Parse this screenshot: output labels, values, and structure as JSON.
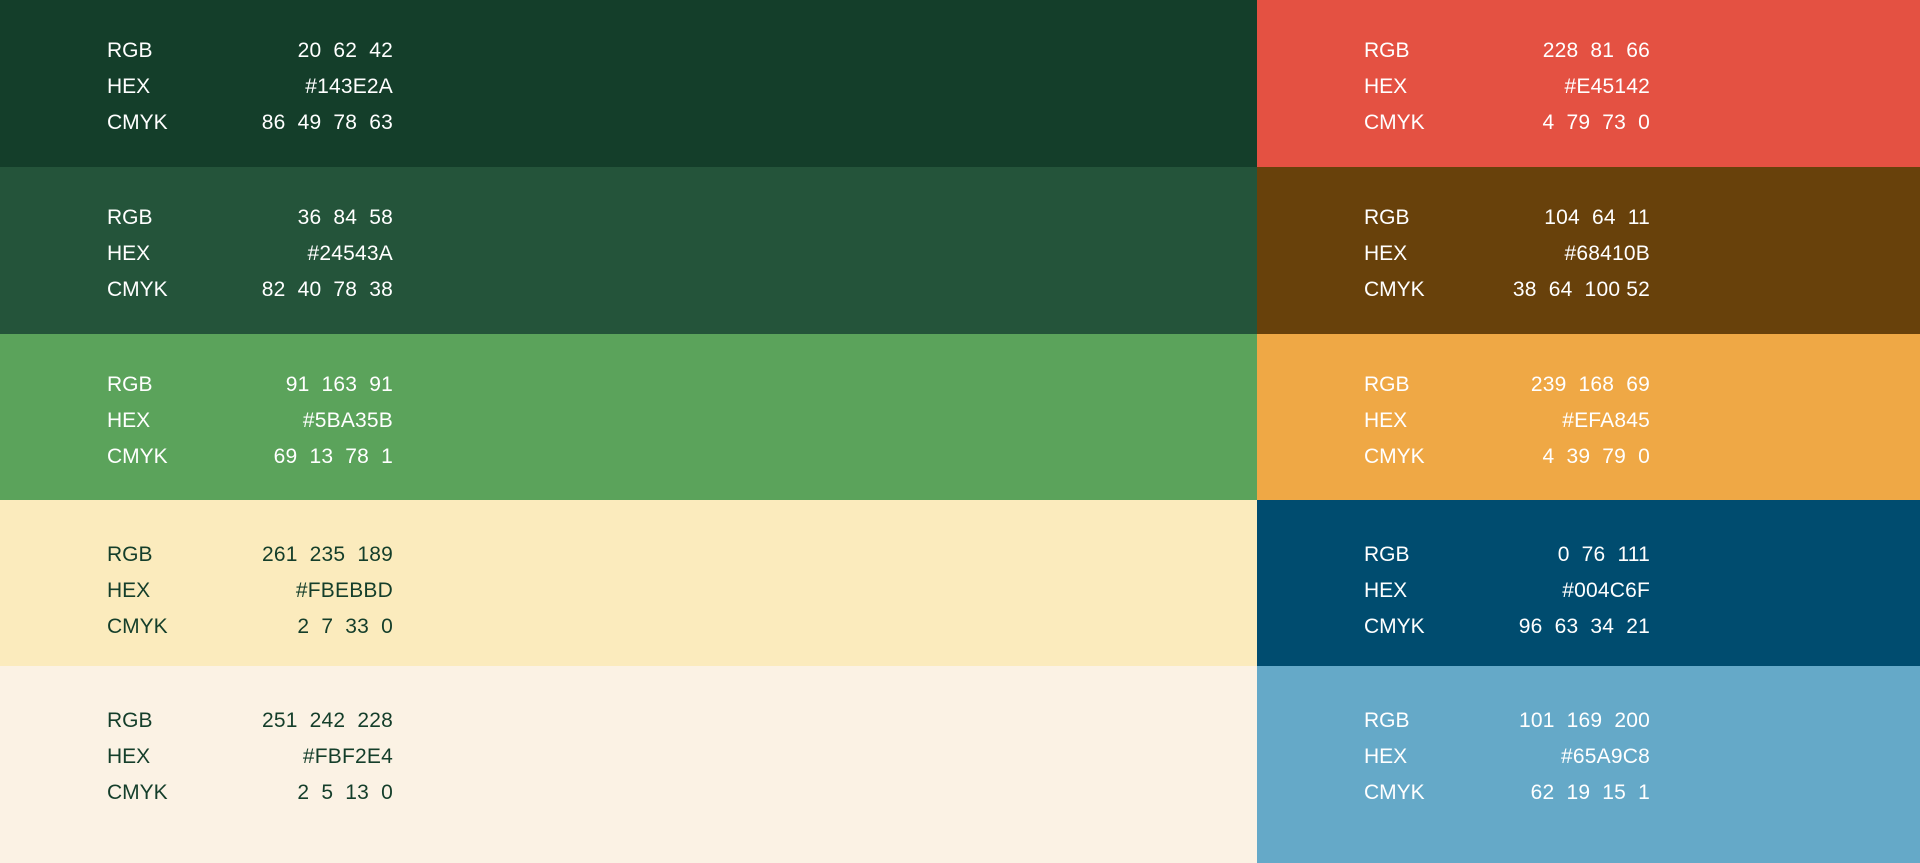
{
  "labels": {
    "rgb": "RGB",
    "hex": "HEX",
    "cmyk": "CMYK"
  },
  "left": [
    {
      "bg": "#143E2A",
      "text_color": "#FFFFFF",
      "rgb": "20  62  42",
      "hex": "#143E2A",
      "cmyk": "86  49  78  63"
    },
    {
      "bg": "#24543A",
      "text_color": "#FFFFFF",
      "rgb": "36  84  58",
      "hex": "#24543A",
      "cmyk": "82  40  78  38"
    },
    {
      "bg": "#5BA35B",
      "text_color": "#FFFFFF",
      "rgb": "91  163  91",
      "hex": "#5BA35B",
      "cmyk": "69  13  78  1"
    },
    {
      "bg": "#FBEBBD",
      "text_color": "#143E2A",
      "rgb": "261  235  189",
      "hex": "#FBEBBD",
      "cmyk": "2  7  33  0"
    },
    {
      "bg": "#FBF2E4",
      "text_color": "#143E2A",
      "rgb": "251  242  228",
      "hex": "#FBF2E4",
      "cmyk": "2  5  13  0"
    }
  ],
  "right": [
    {
      "bg": "#E45142",
      "text_color": "#FFFFFF",
      "rgb": "228  81  66",
      "hex": "#E45142",
      "cmyk": "4  79  73  0"
    },
    {
      "bg": "#68410B",
      "text_color": "#FFFFFF",
      "rgb": "104  64  11",
      "hex": "#68410B",
      "cmyk": "38  64  100 52"
    },
    {
      "bg": "#EFA845",
      "text_color": "#FFFFFF",
      "rgb": "239  168  69",
      "hex": "#EFA845",
      "cmyk": "4  39  79  0"
    },
    {
      "bg": "#004C6F",
      "text_color": "#FFFFFF",
      "rgb": "0  76  111",
      "hex": "#004C6F",
      "cmyk": "96  63  34  21"
    },
    {
      "bg": "#65A9C8",
      "text_color": "#FFFFFF",
      "rgb": "101  169  200",
      "hex": "#65A9C8",
      "cmyk": "62  19  15  1"
    }
  ]
}
